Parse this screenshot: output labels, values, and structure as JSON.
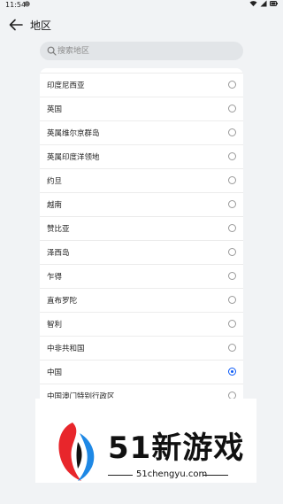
{
  "status_bar": {
    "time": "11:54"
  },
  "header": {
    "title": "地区"
  },
  "search": {
    "placeholder": "搜索地区",
    "value": ""
  },
  "regions": [
    {
      "label": "印度尼西亚",
      "selected": false
    },
    {
      "label": "英国",
      "selected": false
    },
    {
      "label": "英属维尔京群岛",
      "selected": false
    },
    {
      "label": "英属印度洋领地",
      "selected": false
    },
    {
      "label": "约旦",
      "selected": false
    },
    {
      "label": "越南",
      "selected": false
    },
    {
      "label": "赞比亚",
      "selected": false
    },
    {
      "label": "泽西岛",
      "selected": false
    },
    {
      "label": "乍得",
      "selected": false
    },
    {
      "label": "直布罗陀",
      "selected": false
    },
    {
      "label": "智利",
      "selected": false
    },
    {
      "label": "中非共和国",
      "selected": false
    },
    {
      "label": "中国",
      "selected": true
    },
    {
      "label": "中国澳门特别行政区",
      "selected": false
    }
  ],
  "watermark": {
    "title": "51新游戏",
    "subtitle": "51chengyu.com"
  },
  "colors": {
    "accent": "#0a59f7",
    "background": "#f1f3f5",
    "logo_red": "#e8262b",
    "logo_blue": "#1e88e5"
  }
}
